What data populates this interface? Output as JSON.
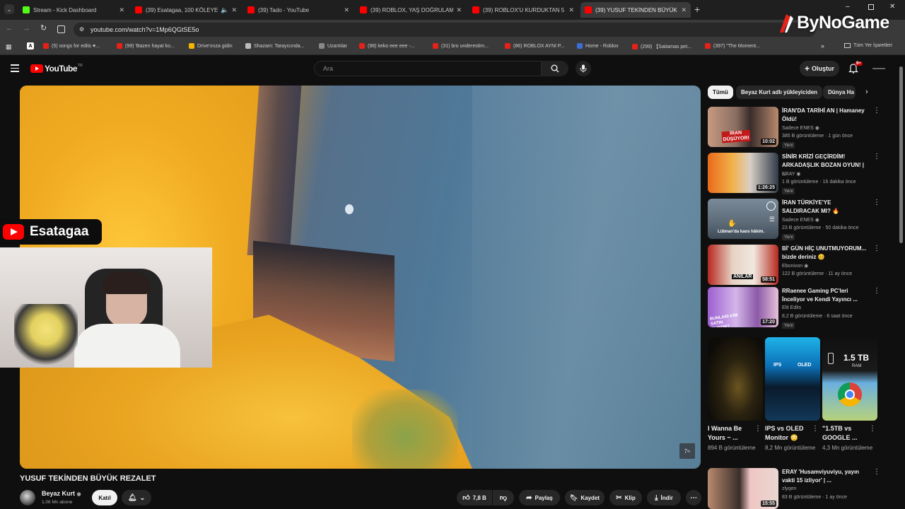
{
  "browser": {
    "tabs": [
      {
        "title": "Stream - Kick Dashboard",
        "color": "#53fc18"
      },
      {
        "title": "(39) Esatagaa, 100 KÖLEYE",
        "color": "#ff0000"
      },
      {
        "title": "(39) Tado - YouTube",
        "color": "#ff0000"
      },
      {
        "title": "(39) ROBLOX, YAŞ DOĞRULAM",
        "color": "#ff0000"
      },
      {
        "title": "(39) ROBLOX'U KURDUKTAN 5",
        "color": "#ff0000"
      },
      {
        "title": "(39) YUSUF TEKİNDEN BÜYÜK",
        "color": "#ff0000"
      }
    ],
    "url": "youtube.com/watch?v=1Mp6QGtSE5o",
    "bookmarks": [
      "(5) songs for edits ♥...",
      "(99) 'Bazen hayat ko...",
      "Drive'ınıza gidin",
      "Shazam: Tarayıcında...",
      "Uzantılar",
      "(98) keko eee eee -...",
      "(31) bro underestim...",
      "(86) ROBLOX AYNI P...",
      "Home - Roblox",
      "(299) 【Saitamas pet...",
      "(397) \"The Moment..."
    ],
    "all_bookmarks": "Tüm Yer İşaretleri"
  },
  "watermark": "ByNoGame",
  "youtube": {
    "logo": "YouTube",
    "logo_sup": "TR",
    "search_placeholder": "Ara",
    "create_label": "Oluştur",
    "notif_count": "9+"
  },
  "overlay": {
    "streamer_name": "Esatagaa",
    "corner_mark": "7≈"
  },
  "video": {
    "title": "YUSUF TEKİNDEN BÜYÜK REZALET",
    "channel": "Beyaz Kurt",
    "subscribers": "1,06 Mn abone",
    "join_label": "Katıl",
    "likes": "7,8 B",
    "share_label": "Paylaş",
    "save_label": "Kaydet",
    "clip_label": "Klip",
    "download_label": "İndir"
  },
  "chips": [
    "Tümü",
    "Beyaz Kurt adlı yükleyiciden",
    "Dünya Ha"
  ],
  "recommendations": [
    {
      "title": "İRAN'DA TARİHİ AN | Hamaney Öldü!",
      "channel": "Sadece ENES",
      "meta": "385 B görüntüleme · 1 gün önce",
      "badge": "Yeni",
      "duration": "10:02",
      "thumb_text": "İRAN DÜŞÜYOR!"
    },
    {
      "title": "SİNİR KRİZİ GEÇİRDİM! ARKADAŞLIK BOZAN OYUN! | ...",
      "channel": "ERAY",
      "meta": "1 B görüntüleme · 16 dakika önce",
      "badge": "Yeni",
      "duration": "1:26:25",
      "thumb_text": ""
    },
    {
      "title": "İRAN TÜRKİYE'YE SALDIRACAK MI? 🔥",
      "channel": "Sadece ENES",
      "meta": "23 B görüntüleme · 50 dakika önce",
      "badge": "Yeni",
      "duration": "",
      "thumb_text": "Lübnan'da kaos hâkim."
    },
    {
      "title": "Bİ' GÜN HİÇ UNUTMUYORUM... bizde deriniz 😊",
      "channel": "Ebonivon",
      "meta": "122 B görüntüleme · 11 ay önce",
      "badge": "",
      "duration": "58:51",
      "thumb_text": "ANILAR"
    },
    {
      "title": "RRaenee Gaming PC'leri İnceliyor ve Kendi Yayıncı ...",
      "channel": "Elit Edits",
      "meta": "8,2 B görüntüleme · 6 saat önce",
      "badge": "Yeni",
      "duration": "17:20",
      "thumb_text": "BUNLARI KİM SATIN ALIYOR?"
    }
  ],
  "shorts": [
    {
      "title": "I Wanna Be Yours ~ ...",
      "views": "894 B görüntüleme"
    },
    {
      "title": "IPS vs OLED Monitor 😳",
      "views": "8,2 Mn görüntüleme",
      "thumb_a": "IPS",
      "thumb_b": "OLED"
    },
    {
      "title": "\"1.5TB vs GOOGLE ...",
      "views": "4,3 Mn görüntüleme",
      "thumb_a": "1.5 TB",
      "thumb_b": "RAM"
    }
  ],
  "bottom_rec": {
    "title": "ERAY 'Husamviyuviyu, yayın vakti 15 izliyor' | ...",
    "channel": "zlyqen",
    "meta": "83 B görüntüleme · 1 ay önce",
    "duration": "15:55"
  }
}
